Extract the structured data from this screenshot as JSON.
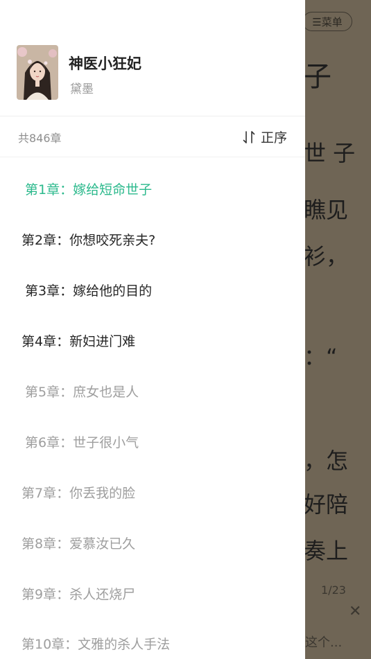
{
  "reader": {
    "menu_label": "☰菜单",
    "lines": [
      "子",
      "世 子",
      "瞧见",
      "衫，",
      "：“",
      "，怎",
      "好陪",
      "奏上"
    ],
    "page_indicator": "1/23",
    "close_glyph": "✕",
    "bottom_hint": "这个..."
  },
  "drawer": {
    "book": {
      "title": "神医小狂妃",
      "author": "黛墨"
    },
    "chapter_count": "共846章",
    "sort_label": "正序",
    "accent_color": "#2bb98c",
    "chapters": [
      {
        "label": "第1章：嫁给短命世子",
        "state": "current"
      },
      {
        "label": "第2章：你想咬死亲夫?",
        "state": "read"
      },
      {
        "label": "第3章：嫁给他的目的",
        "state": "read"
      },
      {
        "label": "第4章：新妇进门难",
        "state": "read"
      },
      {
        "label": "第5章：庶女也是人",
        "state": "unread"
      },
      {
        "label": "第6章：世子很小气",
        "state": "unread"
      },
      {
        "label": "第7章：你丢我的脸",
        "state": "unread"
      },
      {
        "label": "第8章：爱慕汝已久",
        "state": "unread"
      },
      {
        "label": "第9章：杀人还烧尸",
        "state": "unread"
      },
      {
        "label": "第10章：文雅的杀人手法",
        "state": "unread"
      }
    ]
  }
}
